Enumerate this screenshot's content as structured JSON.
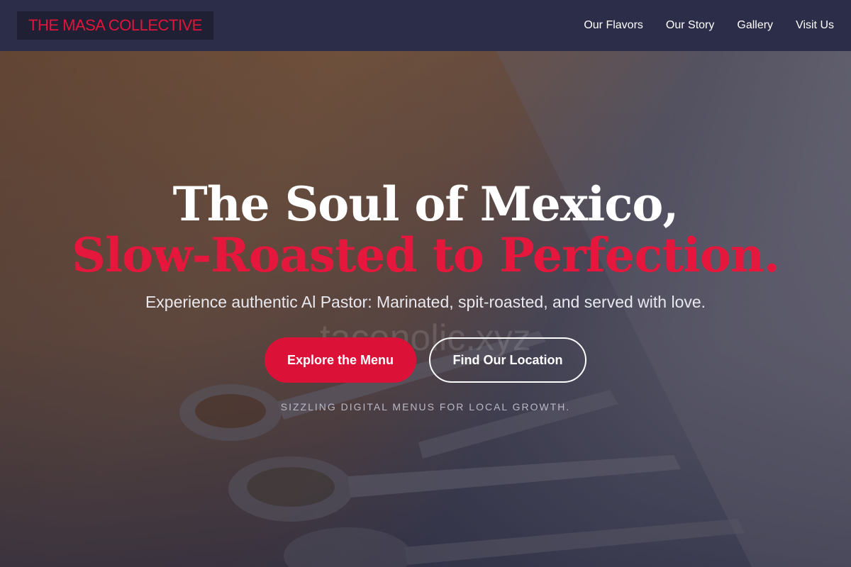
{
  "brand": {
    "name": "THE MASA COLLECTIVE",
    "accent_color": "#e0153a"
  },
  "nav": {
    "items": [
      {
        "label": "Our Flavors"
      },
      {
        "label": "Our Story"
      },
      {
        "label": "Gallery"
      },
      {
        "label": "Visit Us"
      }
    ]
  },
  "hero": {
    "headline_line1": "The Soul of Mexico,",
    "headline_line2": "Slow-Roasted to Perfection.",
    "subtitle": "Experience authentic Al Pastor: Marinated, spit-roasted, and served with love.",
    "primary_button": "Explore the Menu",
    "secondary_button": "Find Our Location",
    "tagline": "SIZZLING DIGITAL MENUS FOR LOCAL GROWTH.",
    "watermark": "taconolic.xyz"
  }
}
